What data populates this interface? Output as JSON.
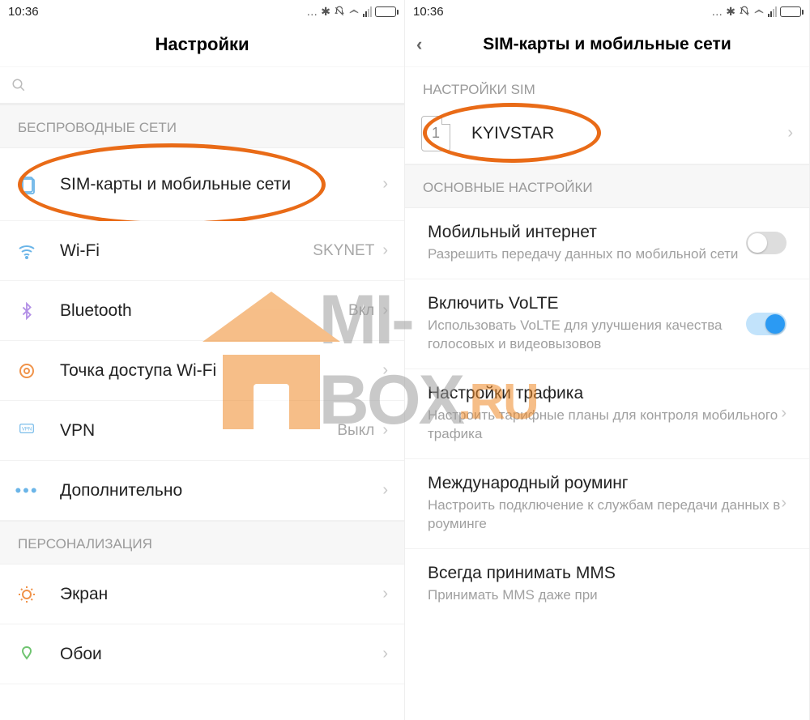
{
  "status": {
    "time": "10:36"
  },
  "left": {
    "title": "Настройки",
    "sections": {
      "wireless": "БЕСПРОВОДНЫЕ СЕТИ",
      "personalization": "ПЕРСОНАЛИЗАЦИЯ"
    },
    "rows": {
      "sim": "SIM-карты и мобильные сети",
      "wifi": {
        "label": "Wi-Fi",
        "value": "SKYNET"
      },
      "bluetooth": {
        "label": "Bluetooth",
        "value": "Вкл"
      },
      "hotspot": "Точка доступа Wi-Fi",
      "vpn": {
        "label": "VPN",
        "value": "Выкл"
      },
      "more": "Дополнительно",
      "display": "Экран",
      "wallpaper": "Обои"
    }
  },
  "right": {
    "title": "SIM-карты и мобильные сети",
    "sections": {
      "sim_settings": "НАСТРОЙКИ SIM",
      "main_settings": "ОСНОВНЫЕ НАСТРОЙКИ"
    },
    "sim_slot_number": "1",
    "sim_name": "KYIVSTAR",
    "rows": {
      "mobile_data": {
        "title": "Мобильный интернет",
        "sub": "Разрешить передачу данных по мобильной сети"
      },
      "volte": {
        "title": "Включить VoLTE",
        "sub": "Использовать VoLTE для улучшения качества голосовых и видеовызовов"
      },
      "traffic": {
        "title": "Настройки трафика",
        "sub": "Настроить тарифные планы для контроля мобильного трафика"
      },
      "roaming": {
        "title": "Международный роуминг",
        "sub": "Настроить подключение к службам передачи данных в роуминге"
      },
      "mms": {
        "title": "Всегда принимать MMS",
        "sub": "Принимать MMS даже при"
      }
    }
  },
  "watermark": {
    "text": "MI-BOX",
    "suffix": ".RU"
  }
}
